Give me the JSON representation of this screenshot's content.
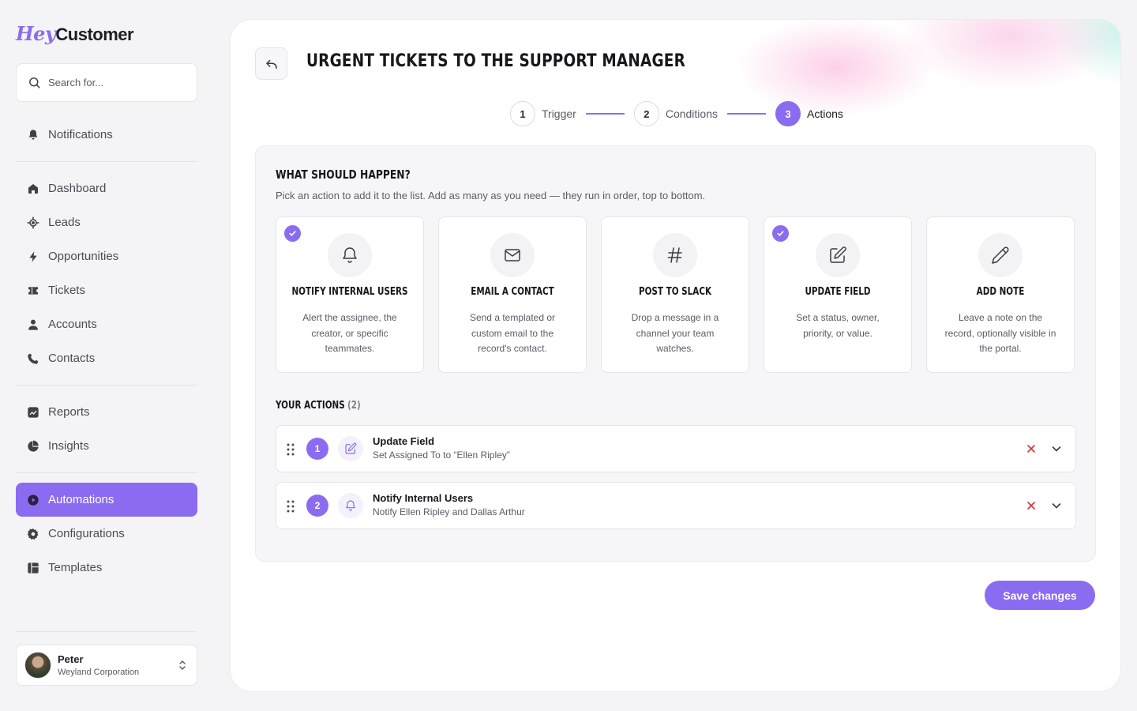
{
  "brand": {
    "logo_prefix": "Hey",
    "logo_suffix": "Customer",
    "accent": "#8b6cf0"
  },
  "search": {
    "placeholder": "Search for..."
  },
  "sidebar": {
    "notifications": "Notifications",
    "items": [
      {
        "label": "Dashboard",
        "icon": "home-icon"
      },
      {
        "label": "Leads",
        "icon": "target-icon"
      },
      {
        "label": "Opportunities",
        "icon": "bolt-icon"
      },
      {
        "label": "Tickets",
        "icon": "ticket-icon"
      },
      {
        "label": "Accounts",
        "icon": "user-icon"
      },
      {
        "label": "Contacts",
        "icon": "phone-icon"
      },
      {
        "label": "Reports",
        "icon": "chart-icon"
      },
      {
        "label": "Insights",
        "icon": "pie-icon"
      },
      {
        "label": "Automations",
        "icon": "play-icon",
        "active": true
      },
      {
        "label": "Configurations",
        "icon": "gear-icon"
      },
      {
        "label": "Templates",
        "icon": "template-icon"
      }
    ]
  },
  "user": {
    "name": "Peter",
    "org": "Weyland Corporation"
  },
  "header": {
    "title": "URGENT TICKETS TO THE SUPPORT MANAGER"
  },
  "stepper": [
    {
      "num": "1",
      "label": "Trigger"
    },
    {
      "num": "2",
      "label": "Conditions"
    },
    {
      "num": "3",
      "label": "Actions",
      "current": true
    }
  ],
  "actions_section": {
    "title": "WHAT SHOULD HAPPEN?",
    "subtitle": "Pick an action to add it to the list. Add as many as you need — they run in order, top to bottom.",
    "cards": [
      {
        "title": "NOTIFY INTERNAL USERS",
        "desc": "Alert the assignee, the creator, or specific teammates.",
        "selected": true,
        "icon": "bell-icon"
      },
      {
        "title": "EMAIL A CONTACT",
        "desc": "Send a templated or custom email to the record's contact.",
        "selected": false,
        "icon": "mail-icon"
      },
      {
        "title": "POST TO SLACK",
        "desc": "Drop a message in a channel your team watches.",
        "selected": false,
        "icon": "hash-icon"
      },
      {
        "title": "UPDATE FIELD",
        "desc": "Set a status, owner, priority, or value.",
        "selected": true,
        "icon": "edit-icon"
      },
      {
        "title": "ADD NOTE",
        "desc": "Leave a note on the record, optionally visible in the portal.",
        "selected": false,
        "icon": "pencil-icon"
      }
    ]
  },
  "your_actions": {
    "title": "YOUR ACTIONS",
    "count": "(2)",
    "rows": [
      {
        "index": "1",
        "title": "Update Field",
        "subtitle": "Set Assigned To to “Ellen Ripley”",
        "icon": "edit-icon"
      },
      {
        "index": "2",
        "title": "Notify Internal Users",
        "subtitle": "Notify Ellen Ripley and Dallas Arthur",
        "icon": "bell-icon"
      }
    ]
  },
  "save_label": "Save changes"
}
